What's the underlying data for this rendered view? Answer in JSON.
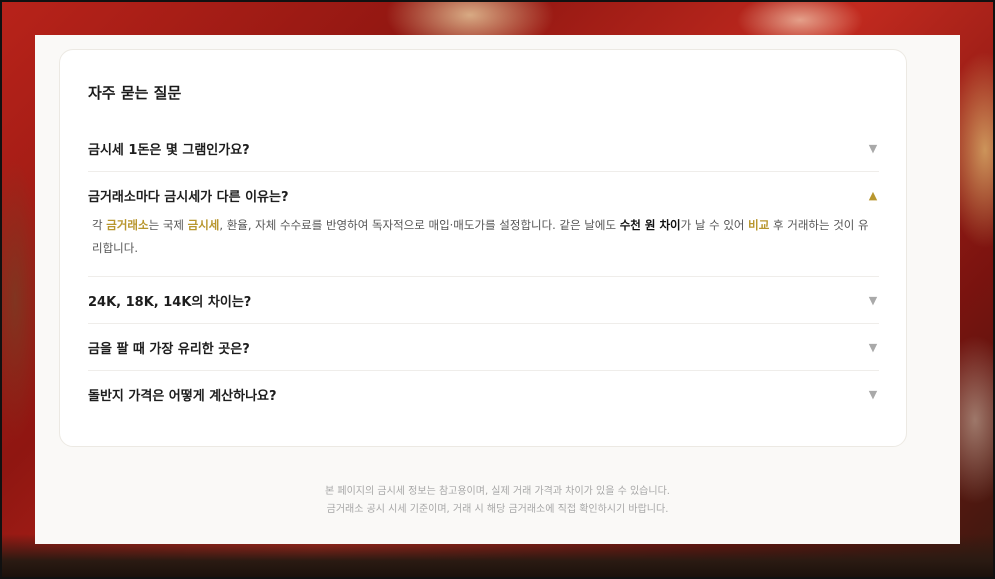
{
  "faq": {
    "title": "자주 묻는 질문",
    "items": [
      {
        "question": "금시세 1돈은 몇 그램인가요?",
        "expanded": false
      },
      {
        "question": "금거래소마다 금시세가 다른 이유는?",
        "expanded": true,
        "answer": {
          "p1": "각 ",
          "h1": "금거래소",
          "p2": "는 국제 ",
          "h2": "금시세",
          "p3": ", 환율, 자체 수수료를 반영하여 독자적으로 매입·매도가를 설정합니다. 같은 날에도 ",
          "h3": "수천 원 차이",
          "p4": "가 날 수 있어 ",
          "h4": "비교",
          "p5": " 후 거래하는 것이 유리합니다."
        }
      },
      {
        "question": "24K, 18K, 14K의 차이는?",
        "expanded": false
      },
      {
        "question": "금을 팔 때 가장 유리한 곳은?",
        "expanded": false
      },
      {
        "question": "돌반지 가격은 어떻게 계산하나요?",
        "expanded": false
      }
    ]
  },
  "footer": {
    "line1": "본 페이지의 금시세 정보는 참고용이며, 실제 거래 가격과 차이가 있을 수 있습니다.",
    "line2": "금거래소 공시 시세 기준이며, 거래 시 해당 금거래소에 직접 확인하시기 바랍니다."
  },
  "icons": {
    "collapsed": "▼",
    "expanded": "▲"
  },
  "colors": {
    "accent": "#b8962e"
  }
}
